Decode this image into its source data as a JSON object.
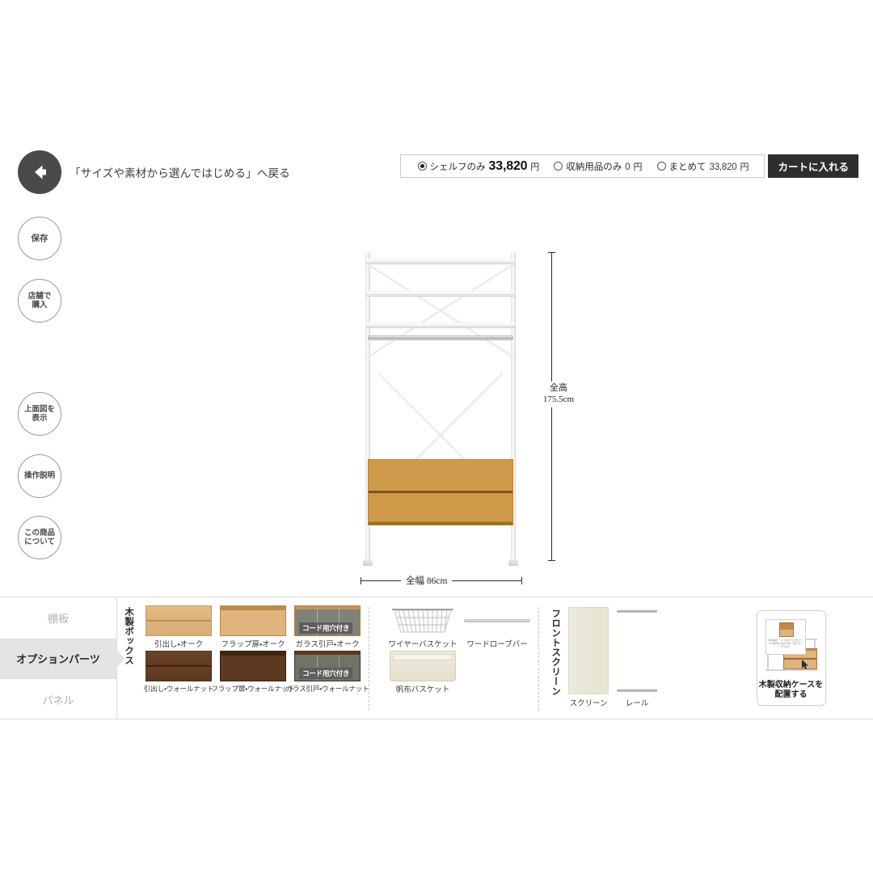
{
  "topbar": {
    "back_label": "「サイズや素材から選んではじめる」へ戻る",
    "back_icon": "arrow-left-icon",
    "price_options": [
      {
        "label": "シェルフのみ",
        "amount": "33,820",
        "unit": "円",
        "selected": true,
        "emphasis": "large"
      },
      {
        "label": "収納用品のみ",
        "amount": "0",
        "unit": "円",
        "selected": false,
        "emphasis": "small"
      },
      {
        "label": "まとめて",
        "amount": "33,820",
        "unit": "円",
        "selected": false,
        "emphasis": "small"
      }
    ],
    "cart_button": "カートに入れる"
  },
  "tools": [
    {
      "name": "save",
      "lines": [
        "保存"
      ]
    },
    {
      "name": "store-purchase",
      "lines": [
        "店舗で",
        "購入"
      ]
    },
    {
      "name": "top-view",
      "lines": [
        "上面図を",
        "表示"
      ]
    },
    {
      "name": "instructions",
      "lines": [
        "操作説明"
      ]
    },
    {
      "name": "about-product",
      "lines": [
        "この商品",
        "について"
      ]
    }
  ],
  "diagram": {
    "height_label_line1": "全高",
    "height_label_line2": "175.5cm",
    "width_label": "全幅 86cm"
  },
  "bottombar": {
    "tabs": [
      {
        "label": "棚板",
        "active": false
      },
      {
        "label": "オプションパーツ",
        "active": true
      },
      {
        "label": "パネル",
        "active": false
      }
    ],
    "groups": [
      {
        "title": "木製ボックス",
        "items": [
          {
            "label": "引出し・オーク",
            "style": "box-oak-drawer",
            "badge": null
          },
          {
            "label": "フラップ扉・オーク",
            "style": "box-oak-flap",
            "badge": null
          },
          {
            "label": "ガラス引戸・オーク",
            "style": "box-oak-glass",
            "badge": "コード用穴付き"
          },
          {
            "label": "引出し・ウォールナット",
            "style": "box-wal-drawer",
            "badge": null
          },
          {
            "label": "フラップ扉・ウォールナット",
            "style": "box-wal-flap",
            "badge": null
          },
          {
            "label": "ガラス引戸・ウォールナット",
            "style": "box-wal-glass",
            "badge": "コード用穴付き"
          }
        ]
      },
      {
        "title": "",
        "items": [
          {
            "label": "ワイヤーバスケット",
            "style": "wirebasket",
            "badge": null
          },
          {
            "label": "ワードローブバー",
            "style": "wbar",
            "badge": null
          },
          {
            "label": "帆布バスケット",
            "style": "canvasbasket",
            "badge": null
          }
        ]
      }
    ],
    "front_screen": {
      "title": "フロントスクリーン",
      "items": [
        {
          "label": "スクリーン",
          "style": "screen-panel"
        },
        {
          "label": "レール",
          "style": "rail-col"
        }
      ]
    },
    "action_card": {
      "label_line1": "木製収納ケースを",
      "label_line2": "配置する",
      "tooltip_text": "木製収納ケース・下台または上置\nコード穴\n棚ダボに載せて置いて使うタイプではない"
    }
  }
}
